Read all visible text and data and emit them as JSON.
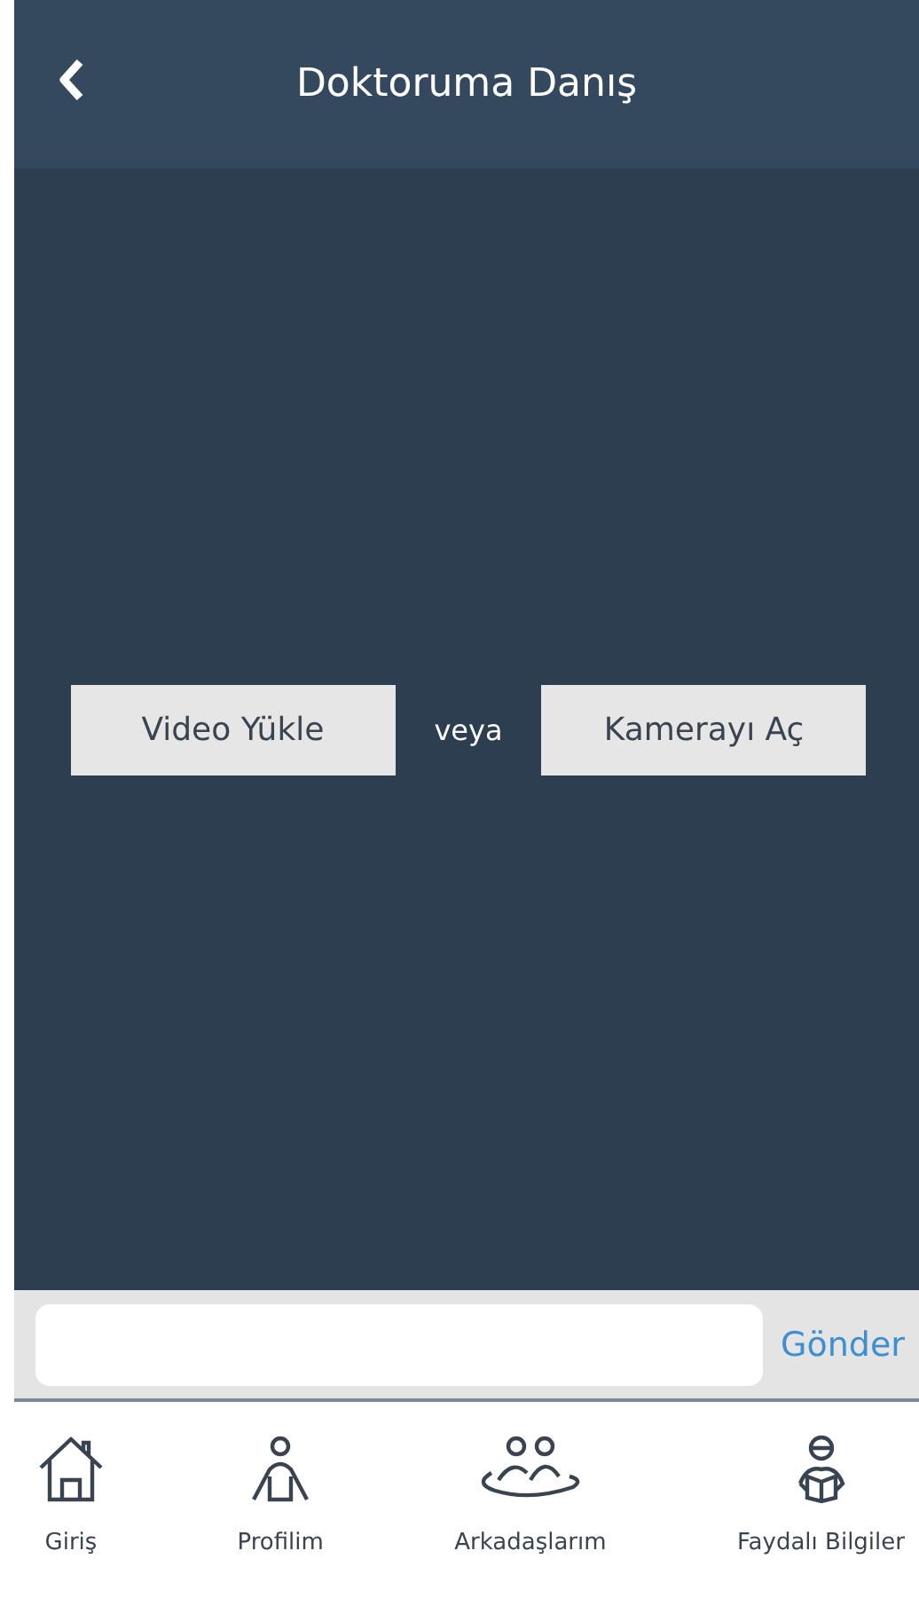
{
  "header": {
    "title": "Doktoruma Danış"
  },
  "actions": {
    "upload": "Video Yükle",
    "separator": "veya",
    "camera": "Kamerayı Aç"
  },
  "composer": {
    "send": "Gönder"
  },
  "tabs": [
    {
      "kind": "home",
      "label": "Giriş"
    },
    {
      "kind": "person",
      "label": "Profilim"
    },
    {
      "kind": "group",
      "label": "Arkadaşlarım"
    },
    {
      "kind": "reader",
      "label": "Faydalı Bilgiler"
    }
  ]
}
